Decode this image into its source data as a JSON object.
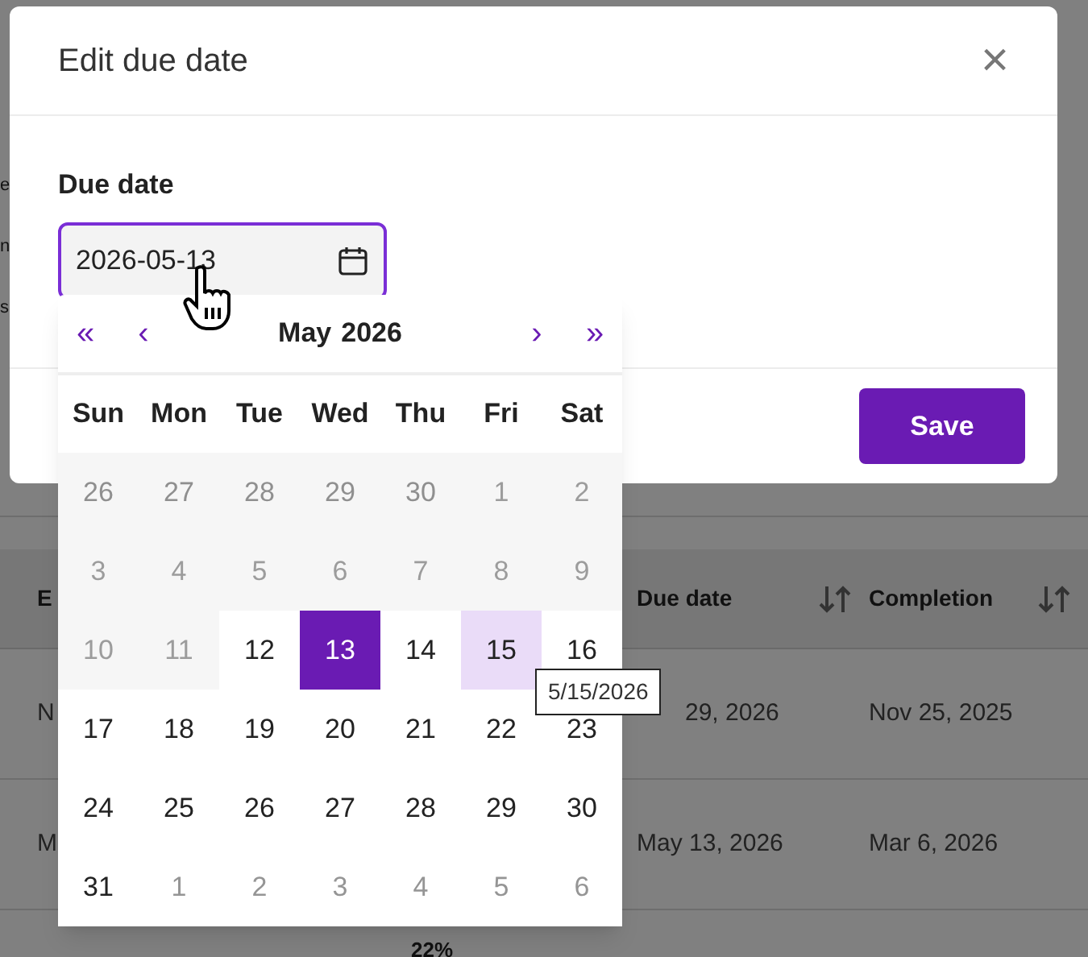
{
  "background": {
    "fragments": [
      "e",
      "n",
      "s"
    ],
    "table": {
      "columns": [
        {
          "label": "E",
          "sortable": false
        },
        {
          "label": "Due date",
          "sortable": true
        },
        {
          "label": "Completion",
          "sortable": true
        }
      ],
      "rows": [
        [
          "N",
          "29, 2026",
          "Nov 25, 2025"
        ],
        [
          "M",
          "May 13, 2026",
          "Mar 6, 2026"
        ]
      ],
      "footer": "22%"
    }
  },
  "dialog": {
    "title": "Edit due date",
    "close": "×",
    "field": {
      "label": "Due date",
      "value": "2026-05-13",
      "focused": true
    },
    "save_button": "Save"
  },
  "date_picker": {
    "nav": [
      "«",
      "‹",
      "›",
      "»"
    ],
    "month": "May",
    "year": "2026",
    "weekdays": [
      "Sun",
      "Mon",
      "Tue",
      "Wed",
      "Thu",
      "Fri",
      "Sat"
    ],
    "weeks": [
      [
        {
          "label": "26",
          "outside": true,
          "disabled": true,
          "selected": false,
          "hovered": false
        },
        {
          "label": "27",
          "outside": true,
          "disabled": true,
          "selected": false,
          "hovered": false
        },
        {
          "label": "28",
          "outside": true,
          "disabled": true,
          "selected": false,
          "hovered": false
        },
        {
          "label": "29",
          "outside": true,
          "disabled": true,
          "selected": false,
          "hovered": false
        },
        {
          "label": "30",
          "outside": true,
          "disabled": true,
          "selected": false,
          "hovered": false
        },
        {
          "label": "1",
          "outside": false,
          "disabled": true,
          "selected": false,
          "hovered": false
        },
        {
          "label": "2",
          "outside": false,
          "disabled": true,
          "selected": false,
          "hovered": false
        }
      ],
      [
        {
          "label": "3",
          "outside": false,
          "disabled": true,
          "selected": false,
          "hovered": false
        },
        {
          "label": "4",
          "outside": false,
          "disabled": true,
          "selected": false,
          "hovered": false
        },
        {
          "label": "5",
          "outside": false,
          "disabled": true,
          "selected": false,
          "hovered": false
        },
        {
          "label": "6",
          "outside": false,
          "disabled": true,
          "selected": false,
          "hovered": false
        },
        {
          "label": "7",
          "outside": false,
          "disabled": true,
          "selected": false,
          "hovered": false
        },
        {
          "label": "8",
          "outside": false,
          "disabled": true,
          "selected": false,
          "hovered": false
        },
        {
          "label": "9",
          "outside": false,
          "disabled": true,
          "selected": false,
          "hovered": false
        }
      ],
      [
        {
          "label": "10",
          "outside": false,
          "disabled": true,
          "selected": false,
          "hovered": false
        },
        {
          "label": "11",
          "outside": false,
          "disabled": true,
          "selected": false,
          "hovered": false
        },
        {
          "label": "12",
          "outside": false,
          "disabled": false,
          "selected": false,
          "hovered": false
        },
        {
          "label": "13",
          "outside": false,
          "disabled": false,
          "selected": true,
          "hovered": false
        },
        {
          "label": "14",
          "outside": false,
          "disabled": false,
          "selected": false,
          "hovered": false
        },
        {
          "label": "15",
          "outside": false,
          "disabled": false,
          "selected": false,
          "hovered": true
        },
        {
          "label": "16",
          "outside": false,
          "disabled": false,
          "selected": false,
          "hovered": false
        }
      ],
      [
        {
          "label": "17",
          "outside": false,
          "disabled": false,
          "selected": false,
          "hovered": false
        },
        {
          "label": "18",
          "outside": false,
          "disabled": false,
          "selected": false,
          "hovered": false
        },
        {
          "label": "19",
          "outside": false,
          "disabled": false,
          "selected": false,
          "hovered": false
        },
        {
          "label": "20",
          "outside": false,
          "disabled": false,
          "selected": false,
          "hovered": false
        },
        {
          "label": "21",
          "outside": false,
          "disabled": false,
          "selected": false,
          "hovered": false
        },
        {
          "label": "22",
          "outside": false,
          "disabled": false,
          "selected": false,
          "hovered": false
        },
        {
          "label": "23",
          "outside": false,
          "disabled": false,
          "selected": false,
          "hovered": false
        }
      ],
      [
        {
          "label": "24",
          "outside": false,
          "disabled": false,
          "selected": false,
          "hovered": false
        },
        {
          "label": "25",
          "outside": false,
          "disabled": false,
          "selected": false,
          "hovered": false
        },
        {
          "label": "26",
          "outside": false,
          "disabled": false,
          "selected": false,
          "hovered": false
        },
        {
          "label": "27",
          "outside": false,
          "disabled": false,
          "selected": false,
          "hovered": false
        },
        {
          "label": "28",
          "outside": false,
          "disabled": false,
          "selected": false,
          "hovered": false
        },
        {
          "label": "29",
          "outside": false,
          "disabled": false,
          "selected": false,
          "hovered": false
        },
        {
          "label": "30",
          "outside": false,
          "disabled": false,
          "selected": false,
          "hovered": false
        }
      ],
      [
        {
          "label": "31",
          "outside": false,
          "disabled": false,
          "selected": false,
          "hovered": false
        },
        {
          "label": "1",
          "outside": true,
          "disabled": false,
          "selected": false,
          "hovered": false
        },
        {
          "label": "2",
          "outside": true,
          "disabled": false,
          "selected": false,
          "hovered": false
        },
        {
          "label": "3",
          "outside": true,
          "disabled": false,
          "selected": false,
          "hovered": false
        },
        {
          "label": "4",
          "outside": true,
          "disabled": false,
          "selected": false,
          "hovered": false
        },
        {
          "label": "5",
          "outside": true,
          "disabled": false,
          "selected": false,
          "hovered": false
        },
        {
          "label": "6",
          "outside": true,
          "disabled": false,
          "selected": false,
          "hovered": false
        }
      ]
    ],
    "tooltip": "5/15/2026"
  }
}
